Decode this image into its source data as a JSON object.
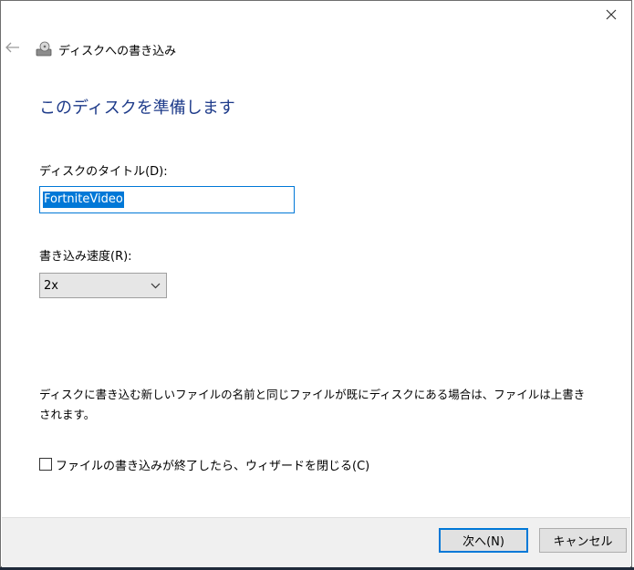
{
  "window": {
    "title": "ディスクへの書き込み",
    "close_icon": "close-icon",
    "back_icon": "back-arrow-icon",
    "title_icon": "disc-burn-icon"
  },
  "heading": "このディスクを準備します",
  "disc_title": {
    "label": "ディスクのタイトル(D):",
    "value": "FortniteVideo"
  },
  "write_speed": {
    "label": "書き込み速度(R):",
    "selected": "2x"
  },
  "notice": "ディスクに書き込む新しいファイルの名前と同じファイルが既にディスクにある場合は、ファイルは上書きされます。",
  "close_wizard_checkbox": {
    "label": "ファイルの書き込みが終了したら、ウィザードを閉じる(C)",
    "checked": false
  },
  "buttons": {
    "next": "次へ(N)",
    "cancel": "キャンセル"
  },
  "colors": {
    "accent": "#0078d7",
    "heading": "#1e3b8a"
  }
}
